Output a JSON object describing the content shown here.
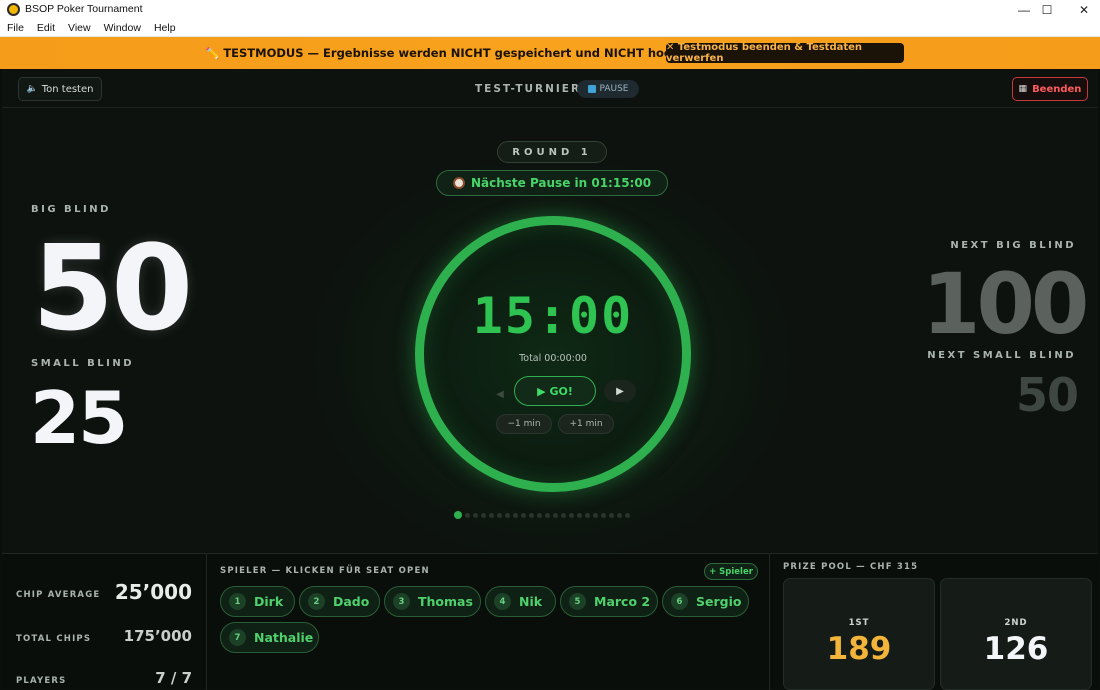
{
  "window": {
    "title": "BSOP Poker Tournament",
    "minimize": "—",
    "maximize": "☐",
    "close": "✕"
  },
  "menu": [
    "File",
    "Edit",
    "View",
    "Window",
    "Help"
  ],
  "banner": {
    "text": "✏️ TESTMODUS — Ergebnisse werden NICHT gespeichert und NICHT hochgeladen",
    "button": "✕ Testmodus beenden & Testdaten verwerfen"
  },
  "topbar": {
    "sound_test": "Ton testen",
    "tournament_name": "TEST-TURNIER",
    "status": "PAUSE",
    "end": "Beenden"
  },
  "center": {
    "round": "ROUND 1",
    "next_break": "Nächste Pause in 01:15:00",
    "timer": "15:00",
    "total": "Total 00:00:00",
    "go": "▶ GO!",
    "minus": "−1 min",
    "plus": "+1 min",
    "level_count": 22,
    "current_level": 1
  },
  "blinds": {
    "big_label": "BIG BLIND",
    "big": "50",
    "small_label": "SMALL BLIND",
    "small": "25",
    "next_big_label": "NEXT BIG BLIND",
    "next_big": "100",
    "next_small_label": "NEXT SMALL BLIND",
    "next_small": "50"
  },
  "stats": {
    "chip_avg_label": "CHIP AVERAGE",
    "chip_avg": "25’000",
    "total_chips_label": "TOTAL CHIPS",
    "total_chips": "175’000",
    "players_label": "PLAYERS",
    "players": "7 / 7"
  },
  "players": {
    "label": "SPIELER — KLICKEN FÜR SEAT OPEN",
    "add": "+ Spieler",
    "list": [
      {
        "seat": "1",
        "name": "Dirk"
      },
      {
        "seat": "2",
        "name": "Dado"
      },
      {
        "seat": "3",
        "name": "Thomas"
      },
      {
        "seat": "4",
        "name": "Nik"
      },
      {
        "seat": "5",
        "name": "Marco 2"
      },
      {
        "seat": "6",
        "name": "Sergio"
      },
      {
        "seat": "7",
        "name": "Nathalie"
      }
    ]
  },
  "prize": {
    "label": "PRIZE POOL — CHF 315",
    "places": [
      {
        "place": "1ST",
        "amount": "189",
        "color": "#f2b53a"
      },
      {
        "place": "2ND",
        "amount": "126",
        "color": "#f3f5f8"
      }
    ]
  }
}
